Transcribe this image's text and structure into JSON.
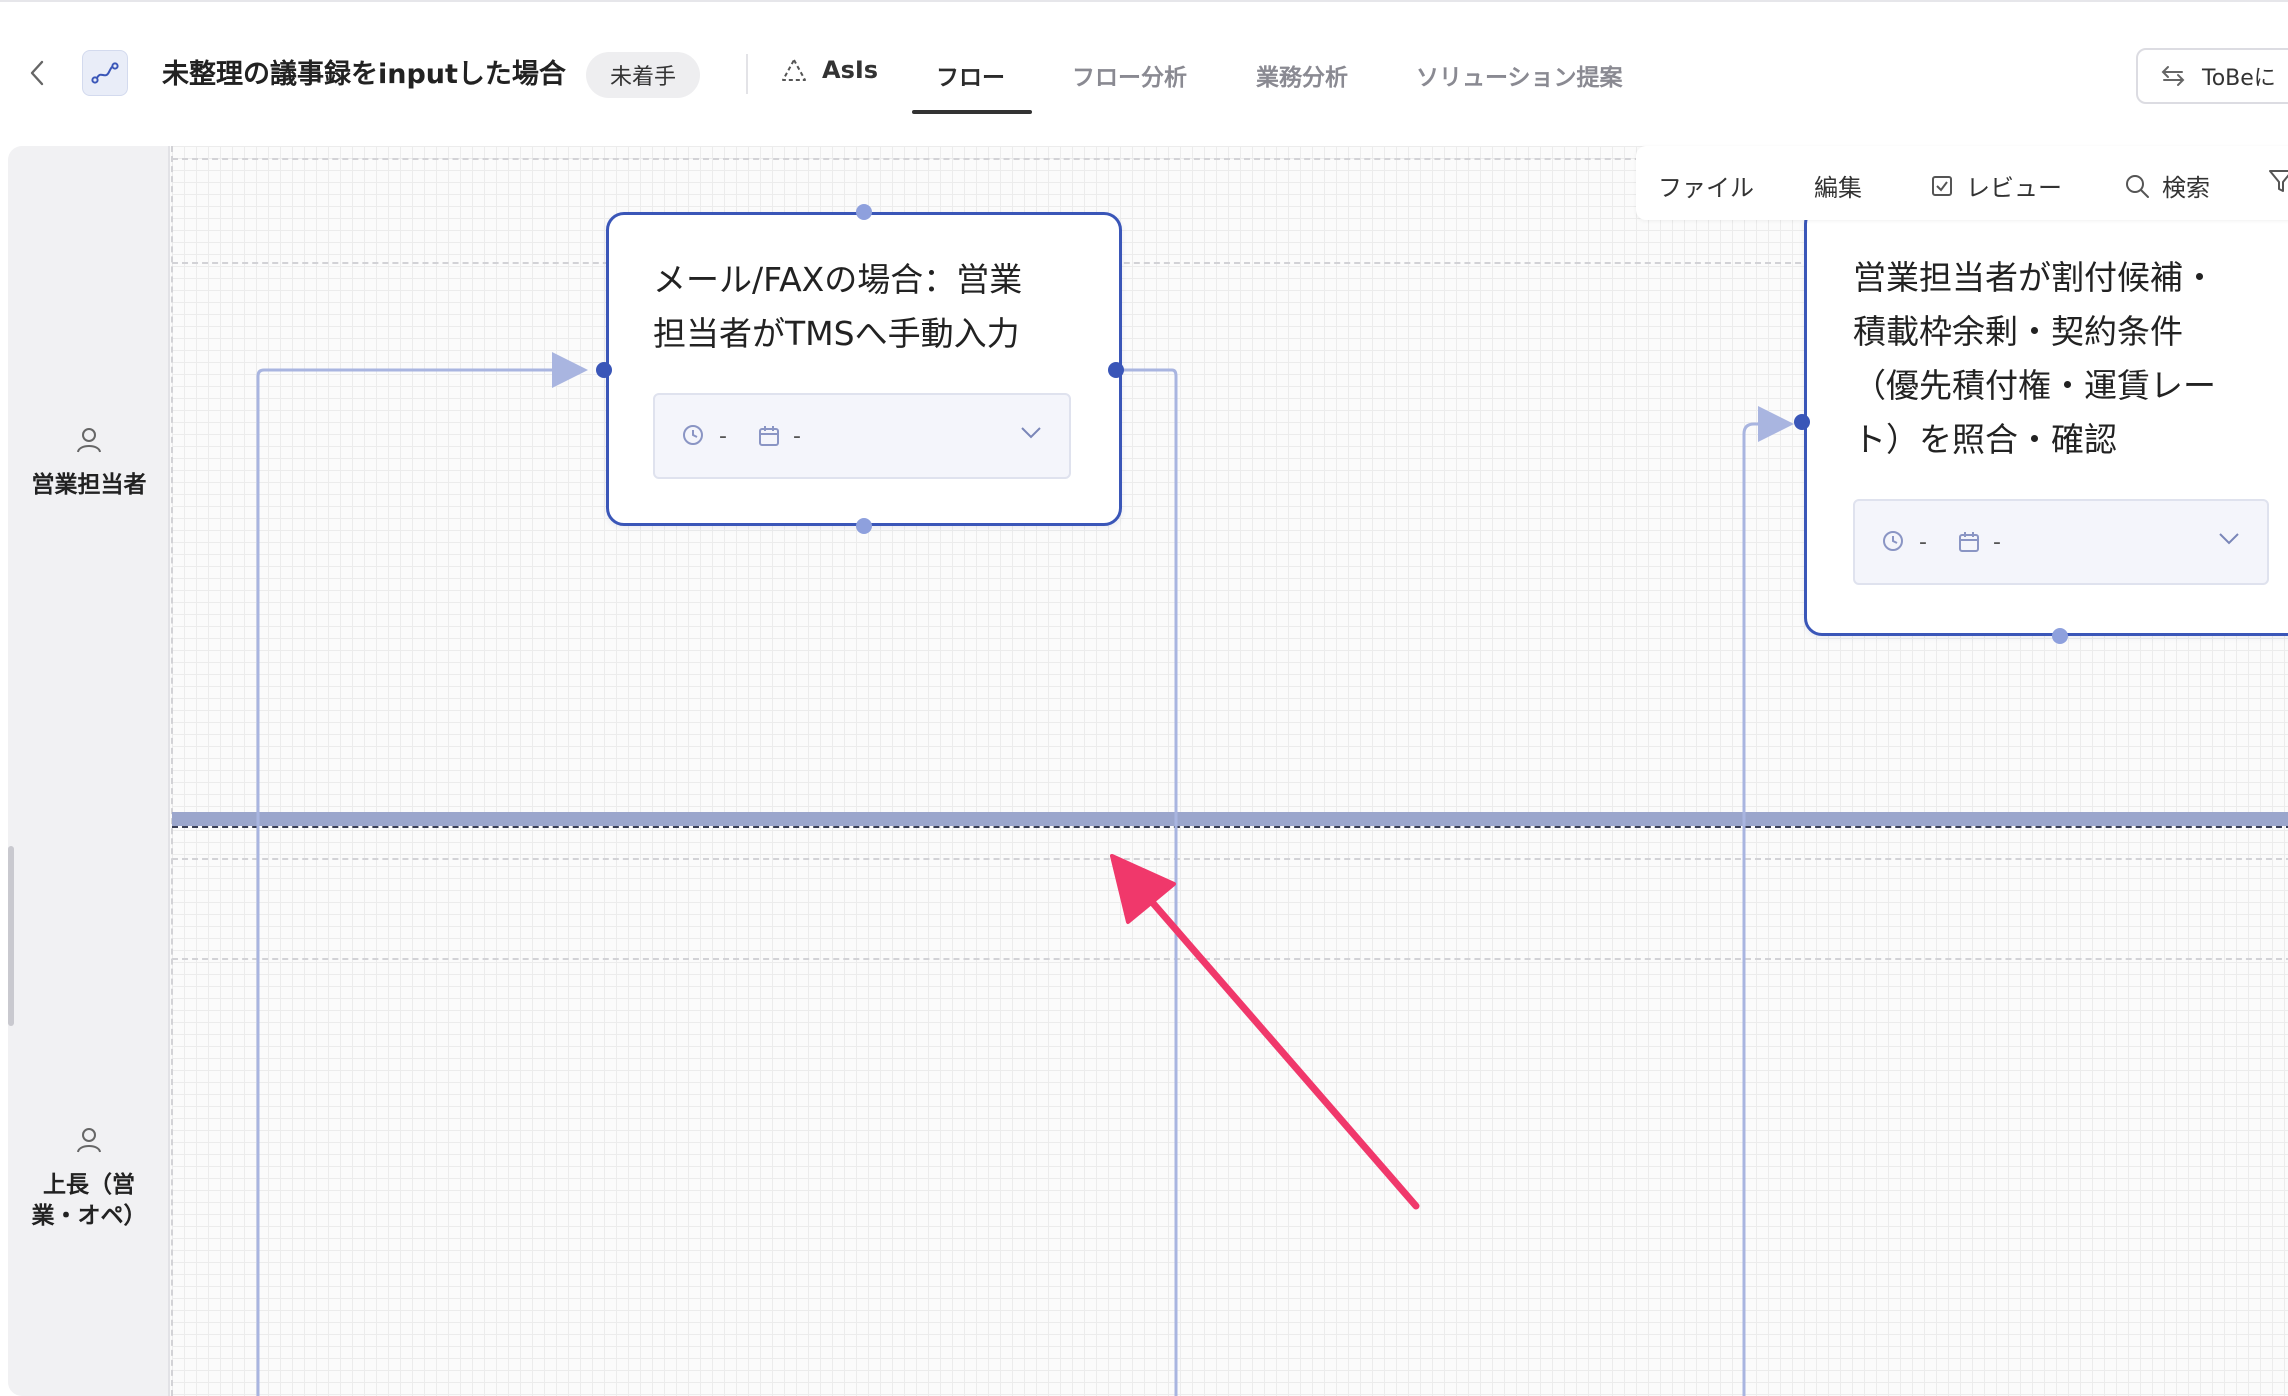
{
  "header": {
    "title": "未整理の議事録をinputした場合",
    "status": "未着手",
    "mode_label": "AsIs",
    "tabs": [
      {
        "label": "フロー",
        "active": true
      },
      {
        "label": "フロー分析",
        "active": false
      },
      {
        "label": "業務分析",
        "active": false
      },
      {
        "label": "ソリューション提案",
        "active": false
      }
    ],
    "tobe_button": "ToBeに"
  },
  "toolbar": {
    "file": "ファイル",
    "edit": "編集",
    "review": "レビュー",
    "search": "検索"
  },
  "lanes": [
    {
      "label": "営業担当者"
    },
    {
      "label": "上長（営業・オペ）"
    }
  ],
  "nodes": [
    {
      "text_line1": "メール/FAXの場合：営業",
      "text_line2": "担当者がTMSへ手動入力",
      "time_value": "-",
      "date_value": "-"
    },
    {
      "text_line1": "営業担当者が割付候補・",
      "text_line2": "積載枠余剰・契約条件",
      "text_line3": "（優先積付権・運賃レー",
      "text_line4": "ト）を照合・確認",
      "time_value": "-",
      "date_value": "-"
    }
  ],
  "colors": {
    "node_border": "#3a56b8",
    "connector": "#a9b5e0",
    "lane_separator": "#9ba6cc",
    "annotation_arrow": "#f0386b"
  },
  "icons": [
    "back-chevron-icon",
    "flow-icon",
    "triangle-icon",
    "swap-icon",
    "checkbox-icon",
    "search-icon",
    "filter-icon",
    "user-icon",
    "clock-icon",
    "calendar-icon",
    "chevron-down-icon"
  ]
}
